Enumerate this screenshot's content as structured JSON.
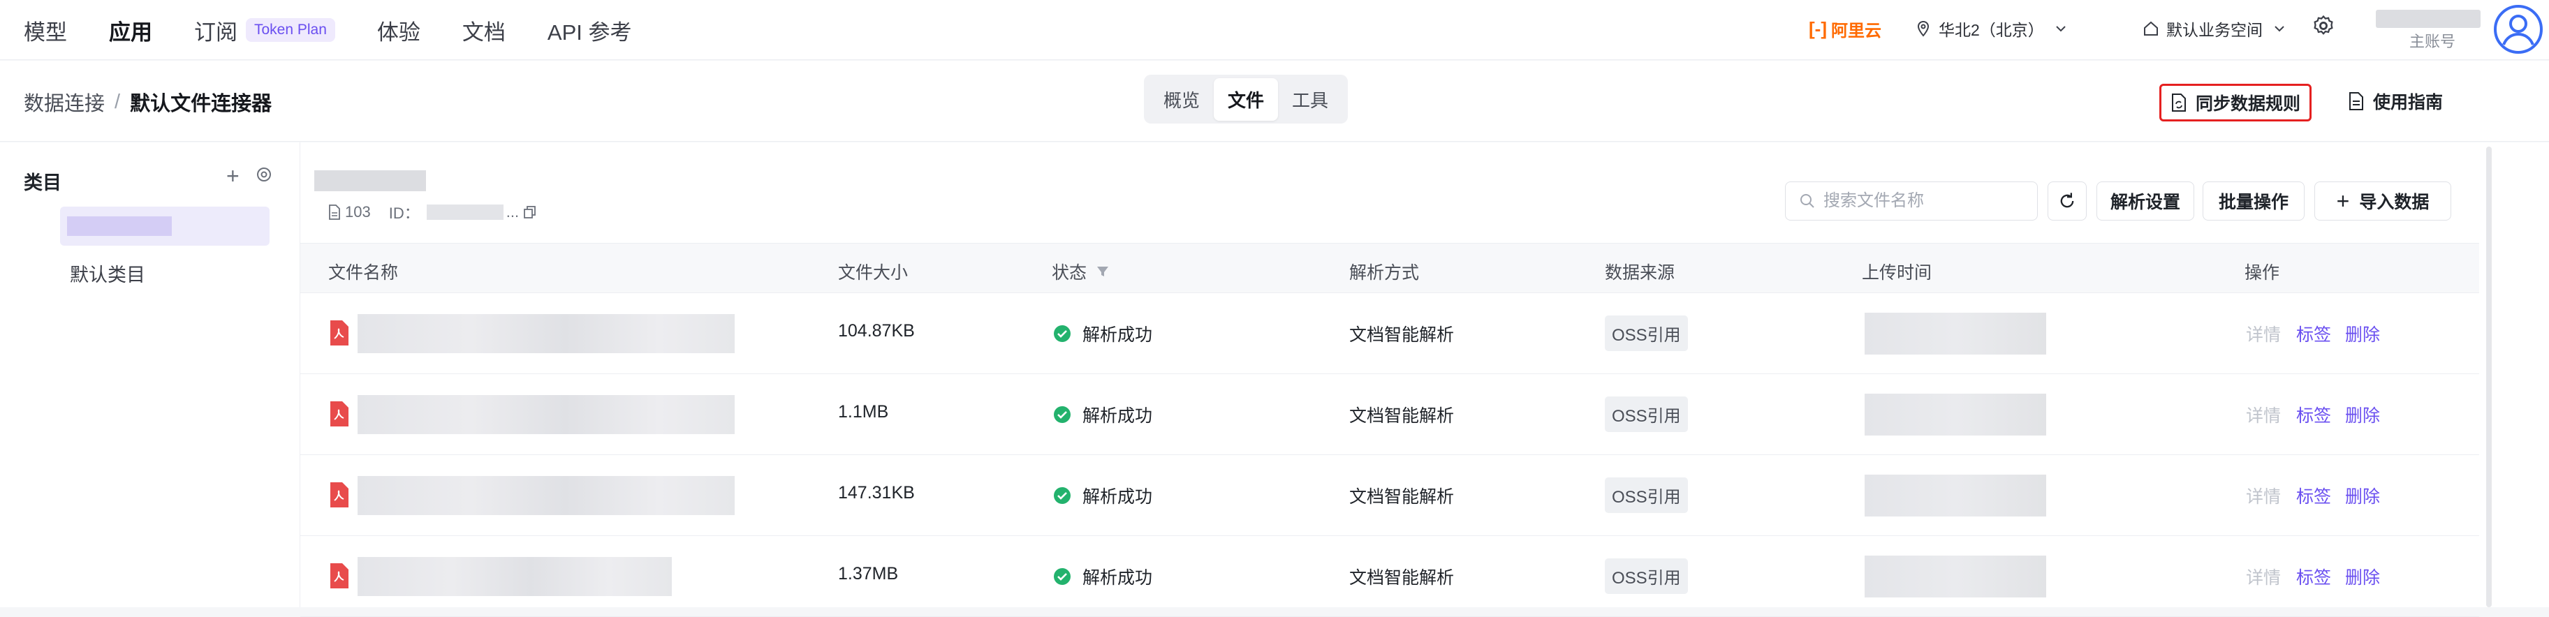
{
  "nav": {
    "items": [
      {
        "label": "模型"
      },
      {
        "label": "应用",
        "active": true
      },
      {
        "label": "订阅",
        "badge": "Token Plan"
      },
      {
        "label": "体验"
      },
      {
        "label": "文档"
      },
      {
        "label": "API 参考"
      }
    ]
  },
  "topbar": {
    "brand": "阿里云",
    "region": "华北2（北京）",
    "workspace": "默认业务空间",
    "account_role": "主账号"
  },
  "breadcrumb": {
    "parent": "数据连接",
    "separator": "/",
    "current": "默认文件连接器"
  },
  "tabs": [
    "概览",
    "文件",
    "工具"
  ],
  "tabs_active": "文件",
  "header_actions": {
    "sync_label": "同步数据规则",
    "guide_label": "使用指南"
  },
  "sidebar": {
    "title": "类目",
    "items": [
      "默认类目"
    ]
  },
  "file_meta": {
    "count": "103",
    "id_label": "ID：",
    "id_suffix": "..."
  },
  "toolbar": {
    "search_placeholder": "搜索文件名称",
    "parse_settings": "解析设置",
    "batch": "批量操作",
    "import": "导入数据"
  },
  "table": {
    "columns": [
      "文件名称",
      "文件大小",
      "状态",
      "解析方式",
      "数据来源",
      "上传时间",
      "操作"
    ],
    "rows": [
      {
        "size": "104.87KB",
        "status": "解析成功",
        "method": "文档智能解析",
        "source": "OSS引用"
      },
      {
        "size": "1.1MB",
        "status": "解析成功",
        "method": "文档智能解析",
        "source": "OSS引用"
      },
      {
        "size": "147.31KB",
        "status": "解析成功",
        "method": "文档智能解析",
        "source": "OSS引用"
      },
      {
        "size": "1.37MB",
        "status": "解析成功",
        "method": "文档智能解析",
        "source": "OSS引用"
      }
    ],
    "actions": {
      "detail": "详情",
      "tag": "标签",
      "delete": "删除"
    }
  },
  "colors": {
    "accent": "#6a4ff0",
    "success": "#23b26d",
    "highlight_border": "#e52020",
    "pdf_red": "#e84b4b",
    "brand_orange": "#ff6a00"
  }
}
